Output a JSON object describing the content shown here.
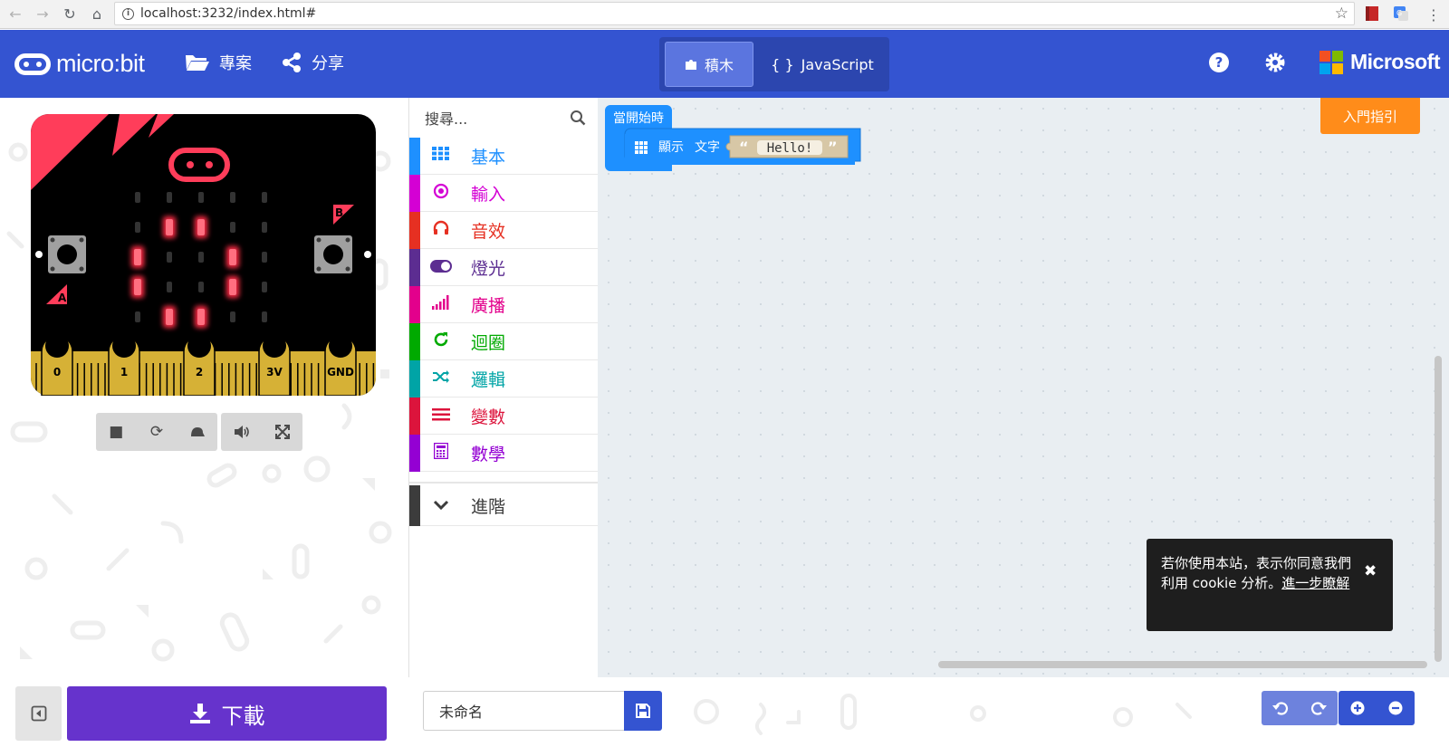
{
  "browser": {
    "url": "localhost:3232/index.html#"
  },
  "header": {
    "brand": "micro:bit",
    "menu_projects": "專案",
    "menu_share": "分享",
    "tab_blocks": "積木",
    "tab_javascript": "JavaScript",
    "tab_javascript_prefix": "{ }",
    "brand_right": "Microsoft"
  },
  "simulator": {
    "pins": [
      "0",
      "1",
      "2",
      "3V",
      "GND"
    ],
    "button_a": "A",
    "button_b": "B",
    "led_matrix": [
      [
        0,
        0,
        0,
        0,
        0
      ],
      [
        0,
        1,
        1,
        0,
        0
      ],
      [
        1,
        0,
        0,
        1,
        0
      ],
      [
        1,
        0,
        0,
        1,
        0
      ],
      [
        0,
        1,
        1,
        0,
        0
      ]
    ]
  },
  "toolbox": {
    "search_placeholder": "搜尋...",
    "categories": [
      {
        "label": "基本",
        "color": "#1E90FF",
        "icon": "grid-icon"
      },
      {
        "label": "輸入",
        "color": "#D400D4",
        "icon": "radio-target-icon"
      },
      {
        "label": "音效",
        "color": "#E63022",
        "icon": "headphones-icon"
      },
      {
        "label": "燈光",
        "color": "#5C2D91",
        "icon": "toggle-icon"
      },
      {
        "label": "廣播",
        "color": "#E3008C",
        "icon": "signal-bars-icon"
      },
      {
        "label": "迴圈",
        "color": "#00AA00",
        "icon": "refresh-icon"
      },
      {
        "label": "邏輯",
        "color": "#00A4A6",
        "icon": "shuffle-icon"
      },
      {
        "label": "變數",
        "color": "#DC143C",
        "icon": "lines-icon"
      },
      {
        "label": "數學",
        "color": "#9400D3",
        "icon": "calculator-icon"
      }
    ],
    "advanced": {
      "label": "進階",
      "color": "#3c3c3c",
      "icon": "chevron-down-icon"
    }
  },
  "workspace": {
    "hat_block_label": "當開始時",
    "show_block_label": "顯示",
    "show_block_param": "文字",
    "string_value": "Hello!",
    "tutorial_button": "入門指引",
    "cookie_text": "若你使用本站，表示你同意我們利用 cookie 分析。",
    "cookie_link": "進一步瞭解"
  },
  "bottom": {
    "download_label": "下載",
    "project_name": "未命名"
  },
  "colors": {
    "header": "#3454d1",
    "download": "#6633cc",
    "tutorial": "#ff8c1a",
    "basic_block": "#1e90ff",
    "string_block": "#d7c7a6"
  }
}
